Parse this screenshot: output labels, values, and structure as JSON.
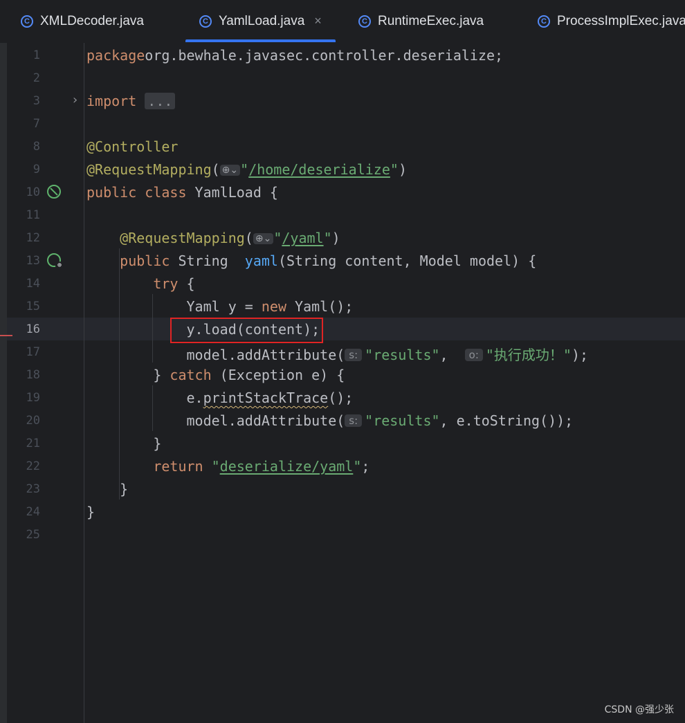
{
  "tabs": [
    {
      "label": "XMLDecoder.java",
      "icon": "class-icon",
      "active": false
    },
    {
      "label": "YamlLoad.java",
      "icon": "class-icon",
      "active": true,
      "closable": true
    },
    {
      "label": "RuntimeExec.java",
      "icon": "class-icon",
      "active": false
    },
    {
      "label": "ProcessImplExec.java",
      "icon": "class-icon",
      "active": false
    }
  ],
  "tab_icon_letter": "C",
  "close_glyph": "×",
  "editor": {
    "current_line": 16,
    "lines": [
      {
        "num": "1",
        "tokens": [
          [
            "kw",
            "package"
          ],
          [
            "",
            "org.bewhale.javasec.controller.deserialize;"
          ]
        ]
      },
      {
        "num": "2",
        "tokens": []
      },
      {
        "num": "3",
        "tokens": [
          [
            "kw",
            "import"
          ],
          [
            "",
            " "
          ],
          [
            "fold",
            "..."
          ]
        ]
      },
      {
        "num": "7",
        "tokens": []
      },
      {
        "num": "8",
        "tokens": [
          [
            "ann",
            "@Controller"
          ]
        ]
      },
      {
        "num": "9",
        "tokens": [
          [
            "ann",
            "@RequestMapping"
          ],
          [
            "",
            "("
          ],
          [
            "globe",
            ""
          ],
          [
            "str",
            "\""
          ],
          [
            "url",
            "/home/deserialize"
          ],
          [
            "str",
            "\""
          ],
          [
            "",
            ")"
          ]
        ]
      },
      {
        "num": "10",
        "tokens": [
          [
            "kw",
            "public class"
          ],
          [
            "",
            " YamlLoad {"
          ]
        ]
      },
      {
        "num": "11",
        "tokens": []
      },
      {
        "num": "12",
        "tokens": [
          [
            "",
            "    "
          ],
          [
            "ann",
            "@RequestMapping"
          ],
          [
            "",
            "("
          ],
          [
            "globe",
            ""
          ],
          [
            "str",
            "\""
          ],
          [
            "url",
            "/yaml"
          ],
          [
            "str",
            "\""
          ],
          [
            "",
            ")"
          ]
        ]
      },
      {
        "num": "13",
        "tokens": [
          [
            "",
            "    "
          ],
          [
            "kw",
            "public"
          ],
          [
            "",
            " String  "
          ],
          [
            "fn",
            "yaml"
          ],
          [
            "",
            "(String content, Model model) {"
          ]
        ]
      },
      {
        "num": "14",
        "tokens": [
          [
            "",
            "        "
          ],
          [
            "kw",
            "try"
          ],
          [
            "",
            " {"
          ]
        ]
      },
      {
        "num": "15",
        "tokens": [
          [
            "",
            "            Yaml y = "
          ],
          [
            "kw",
            "new"
          ],
          [
            "",
            " Yaml();"
          ]
        ]
      },
      {
        "num": "16",
        "tokens": [
          [
            "",
            "            y.load(content);"
          ]
        ]
      },
      {
        "num": "17",
        "tokens": [
          [
            "",
            "            model.addAttribute("
          ],
          [
            "hint",
            "s:"
          ],
          [
            "str",
            "\"results\""
          ],
          [
            "",
            ",  "
          ],
          [
            "hint",
            "o:"
          ],
          [
            "str",
            "\"执行成功！\""
          ],
          [
            "",
            ");"
          ]
        ]
      },
      {
        "num": "18",
        "tokens": [
          [
            "",
            "        } "
          ],
          [
            "kw",
            "catch"
          ],
          [
            "",
            " (Exception e) {"
          ]
        ]
      },
      {
        "num": "19",
        "tokens": [
          [
            "",
            "            e."
          ],
          [
            "warn",
            "printStackTrace"
          ],
          [
            "",
            "();"
          ]
        ]
      },
      {
        "num": "20",
        "tokens": [
          [
            "",
            "            model.addAttribute("
          ],
          [
            "hint",
            "s:"
          ],
          [
            "str",
            "\"results\""
          ],
          [
            "",
            ", e.toString());"
          ]
        ]
      },
      {
        "num": "21",
        "tokens": [
          [
            "",
            "        }"
          ]
        ]
      },
      {
        "num": "22",
        "tokens": [
          [
            "",
            "        "
          ],
          [
            "kw",
            "return"
          ],
          [
            "",
            " "
          ],
          [
            "str",
            "\""
          ],
          [
            "url",
            "deserialize/yaml"
          ],
          [
            "str",
            "\""
          ],
          [
            "",
            ";"
          ]
        ]
      },
      {
        "num": "23",
        "tokens": [
          [
            "",
            "    }"
          ]
        ]
      },
      {
        "num": "24",
        "tokens": [
          [
            "",
            "}"
          ]
        ]
      },
      {
        "num": "25",
        "tokens": []
      }
    ]
  },
  "globe_hint": "⊕⌄",
  "fold_chevron": "›",
  "colors": {
    "keyword": "#cf8e6d",
    "annotation": "#b3ae60",
    "string": "#6aab73",
    "method": "#56a8f5",
    "highlight_box": "#e02424",
    "tab_accent": "#3574f0"
  },
  "watermark": "CSDN @强少张"
}
